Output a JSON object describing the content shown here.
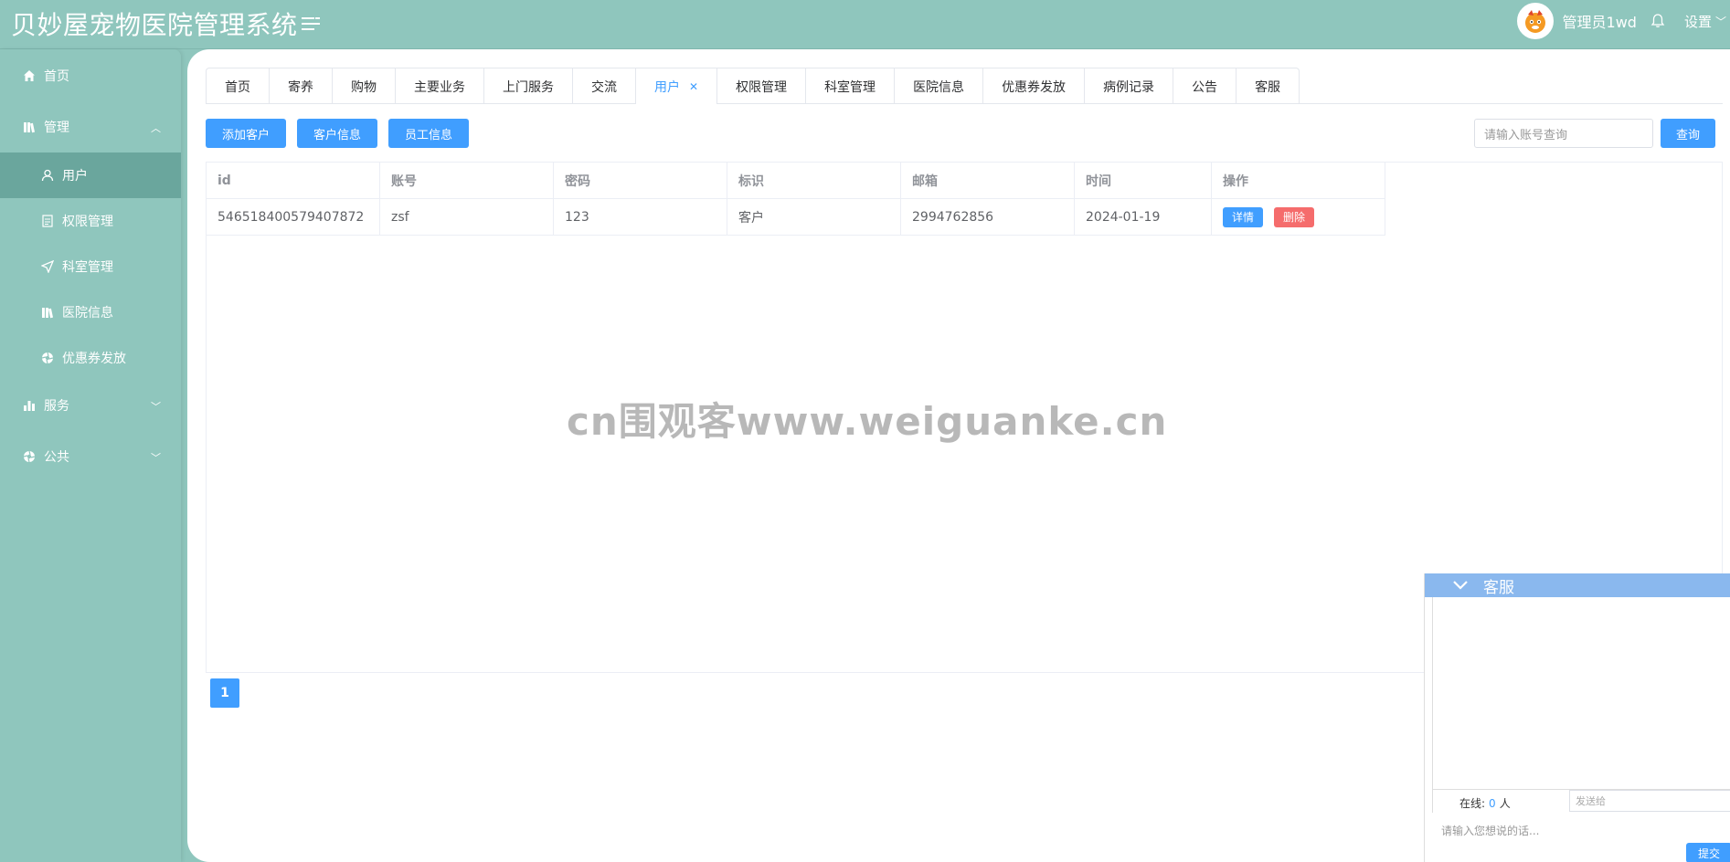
{
  "header": {
    "title": "贝妙屋宠物医院管理系统",
    "admin_name": "管理员1wd",
    "settings_label": "设置"
  },
  "sidebar": {
    "items": [
      {
        "label": "首页",
        "icon": "home-icon"
      },
      {
        "label": "管理",
        "icon": "library-icon",
        "expanded": true
      },
      {
        "label": "服务",
        "icon": "bar-chart-icon"
      },
      {
        "label": "公共",
        "icon": "aperture-icon"
      }
    ],
    "sub_items": [
      {
        "label": "用户",
        "icon": "user-icon",
        "active": true
      },
      {
        "label": "权限管理",
        "icon": "document-icon"
      },
      {
        "label": "科室管理",
        "icon": "send-icon"
      },
      {
        "label": "医院信息",
        "icon": "library-icon"
      },
      {
        "label": "优惠券发放",
        "icon": "aperture-icon"
      }
    ]
  },
  "tabs": [
    {
      "label": "首页"
    },
    {
      "label": "寄养"
    },
    {
      "label": "购物"
    },
    {
      "label": "主要业务"
    },
    {
      "label": "上门服务"
    },
    {
      "label": "交流"
    },
    {
      "label": "用户",
      "active": true
    },
    {
      "label": "权限管理"
    },
    {
      "label": "科室管理"
    },
    {
      "label": "医院信息"
    },
    {
      "label": "优惠券发放"
    },
    {
      "label": "病例记录"
    },
    {
      "label": "公告"
    },
    {
      "label": "客服"
    }
  ],
  "toolbar": {
    "add_customer": "添加客户",
    "customer_info": "客户信息",
    "staff_info": "员工信息",
    "search_placeholder": "请输入账号查询",
    "search_button": "查询"
  },
  "table": {
    "columns": [
      "id",
      "账号",
      "密码",
      "标识",
      "邮箱",
      "时间",
      "操作"
    ],
    "rows": [
      {
        "id": "546518400579407872",
        "account": "zsf",
        "password": "123",
        "role": "客户",
        "email": "2994762856",
        "time": "2024-01-19",
        "detail_label": "详情",
        "delete_label": "删除"
      }
    ]
  },
  "pagination": {
    "current": "1"
  },
  "watermark": "cn围观客www.weiguanke.cn",
  "chat": {
    "title": "客服",
    "online_label": "在线:",
    "online_count": "0",
    "online_unit": "人",
    "send_to_placeholder": "发送给",
    "input_placeholder": "请输入您想说的话...",
    "submit_label": "提交"
  },
  "colors": {
    "primary": "#409eff",
    "sidebar": "#8fc6bd",
    "danger": "#f56c6c"
  }
}
